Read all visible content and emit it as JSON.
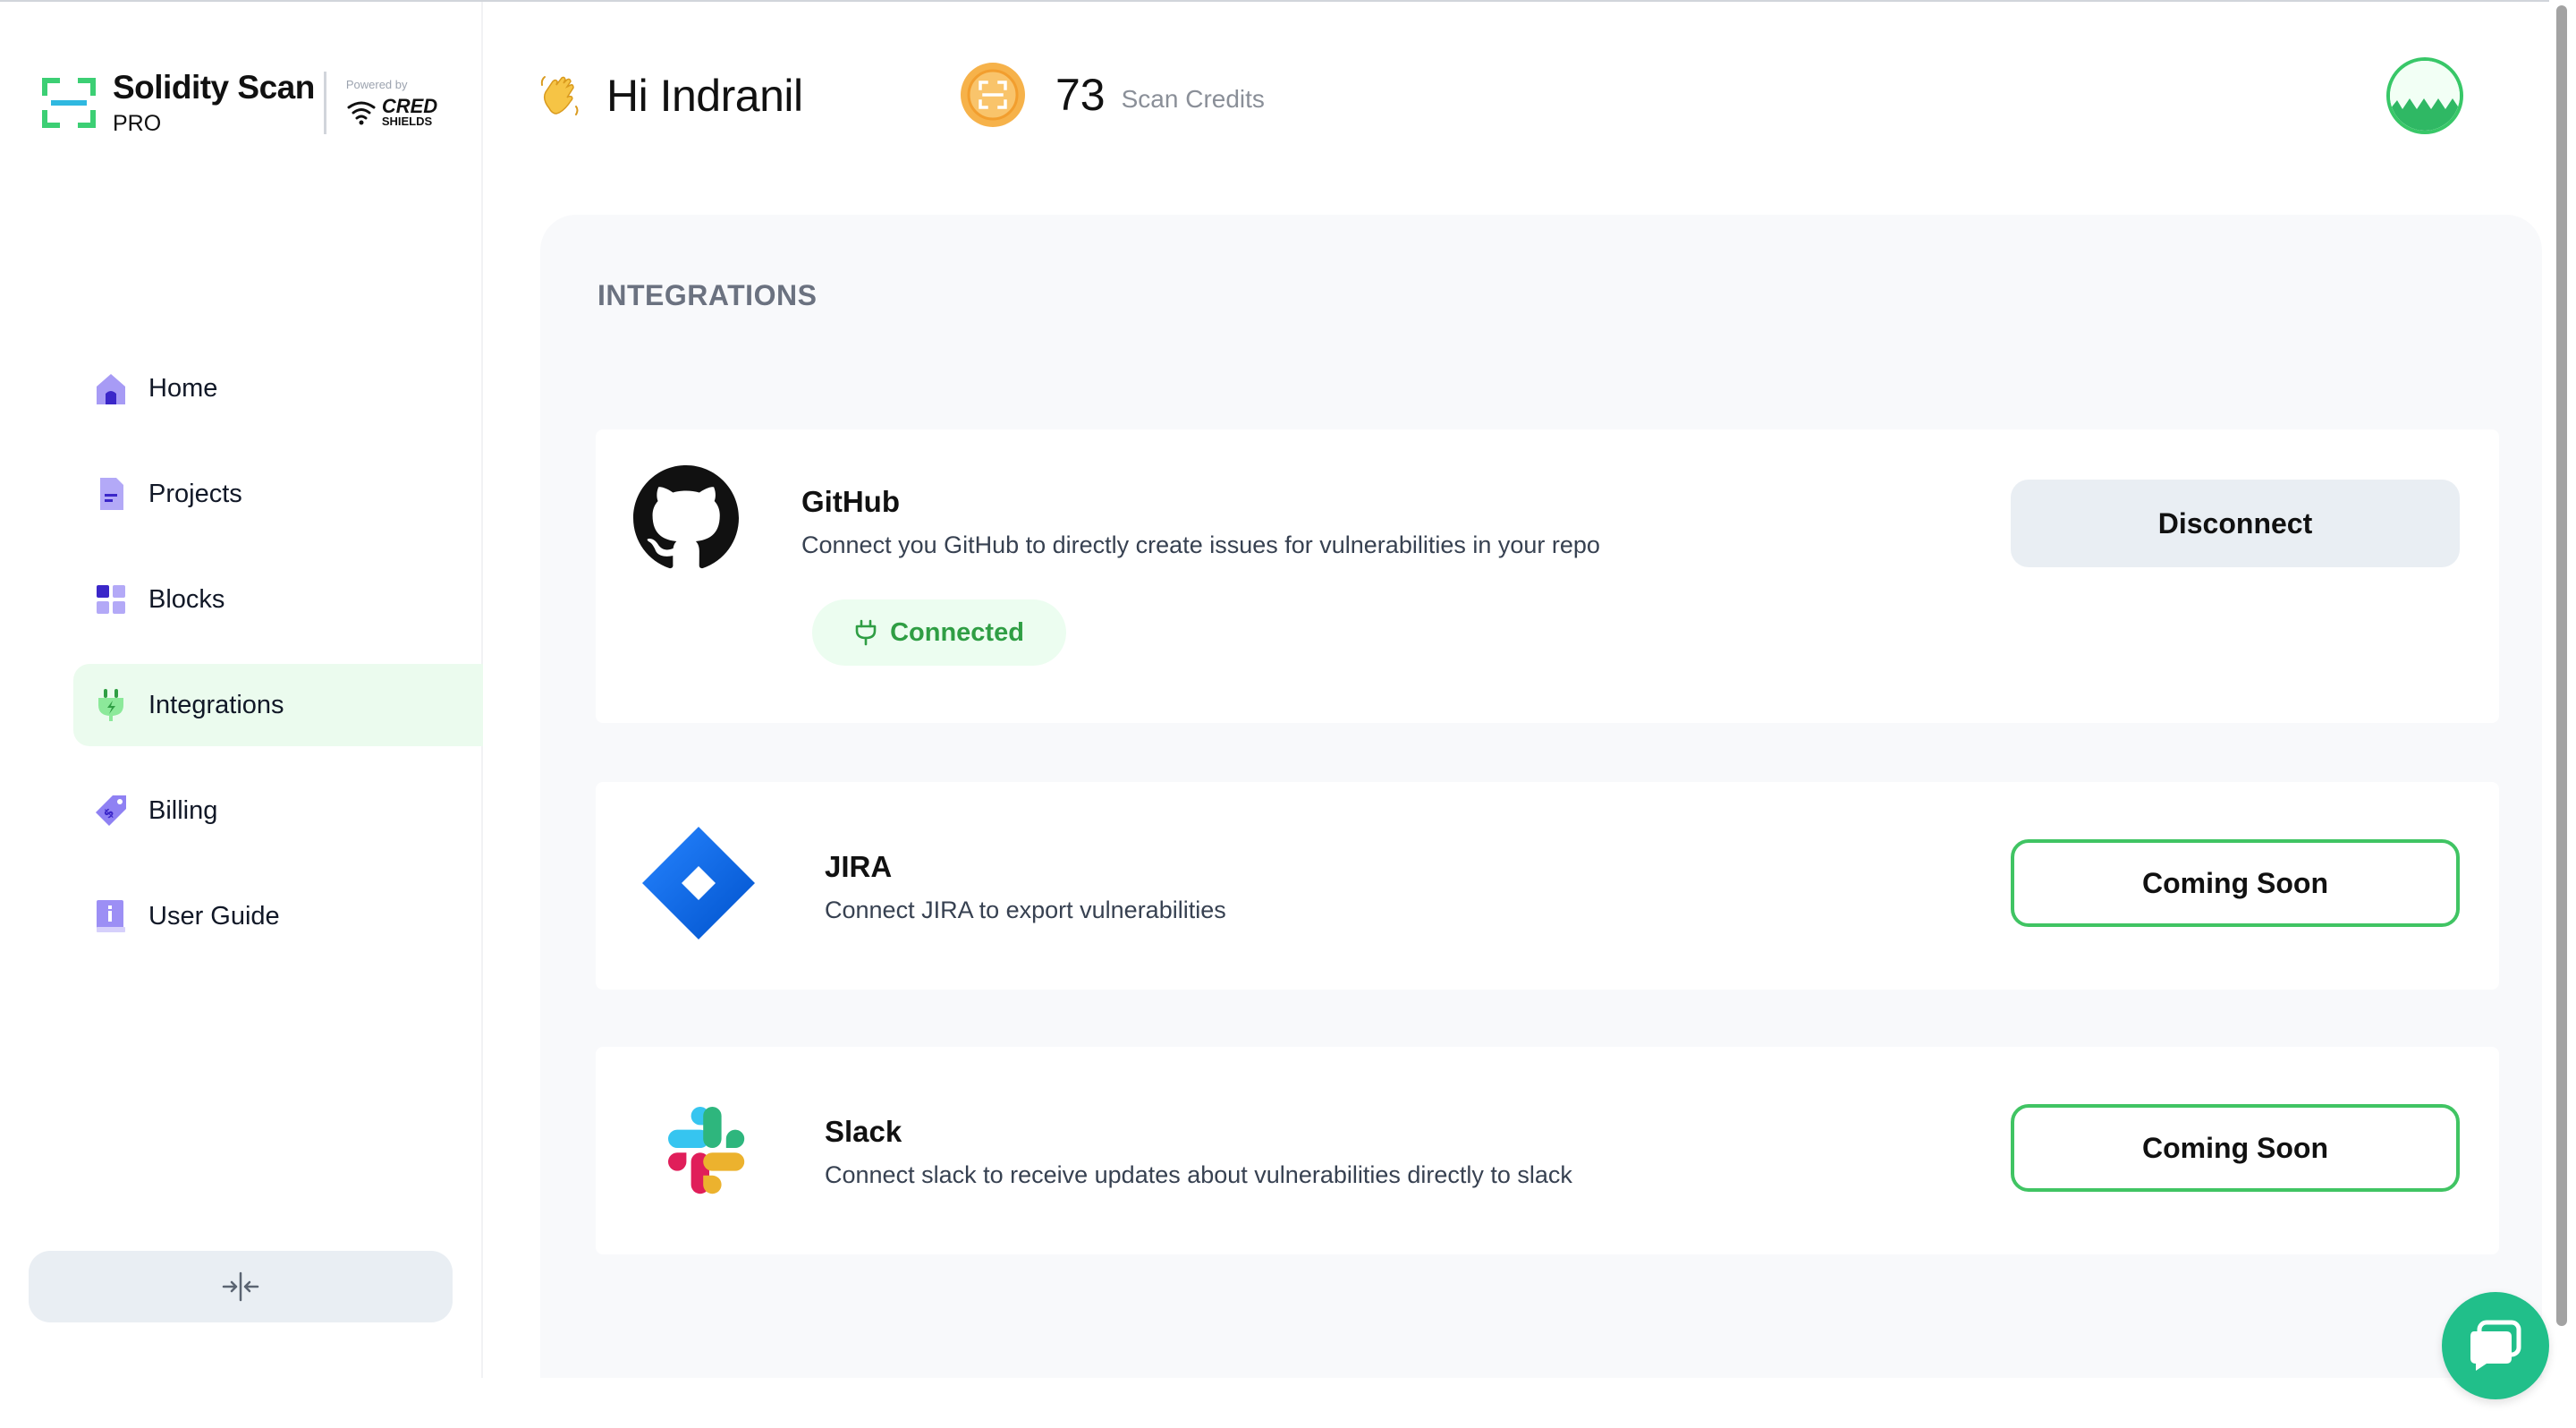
{
  "brand": {
    "name": "Solidity Scan",
    "tier": "PRO",
    "powered_by": "Powered by",
    "partner_line1": "CRED",
    "partner_line2": "SHIELDS"
  },
  "sidebar": {
    "items": [
      {
        "label": "Home",
        "icon": "home-icon"
      },
      {
        "label": "Projects",
        "icon": "document-icon"
      },
      {
        "label": "Blocks",
        "icon": "grid-blocks-icon"
      },
      {
        "label": "Integrations",
        "icon": "plug-icon",
        "active": true
      },
      {
        "label": "Billing",
        "icon": "price-tag-icon"
      },
      {
        "label": "User Guide",
        "icon": "book-info-icon"
      }
    ],
    "collapse_icon": "collapse-arrows-icon"
  },
  "header": {
    "greeting": "Hi Indranil",
    "greeting_icon": "waving-hand-icon",
    "credits_count": "73",
    "credits_label": "Scan Credits",
    "credits_icon": "scan-coin-icon"
  },
  "main": {
    "section_title": "INTEGRATIONS",
    "integrations": [
      {
        "name": "GitHub",
        "description": "Connect you GitHub to directly create issues for vulnerabilities in your repo",
        "status": "Connected",
        "action_label": "Disconnect",
        "icon": "github-icon"
      },
      {
        "name": "JIRA",
        "description": "Connect JIRA to export vulnerabilities",
        "action_label": "Coming Soon",
        "icon": "jira-icon"
      },
      {
        "name": "Slack",
        "description": "Connect slack to receive updates about vulnerabilities directly to slack",
        "action_label": "Coming Soon",
        "icon": "slack-icon"
      }
    ]
  },
  "colors": {
    "accent_green": "#40c463",
    "active_nav_bg": "#ebfbee",
    "connected_text": "#2f9e44",
    "chat_button": "#21bf8a",
    "nav_icon_purple": "#7c6cf0"
  }
}
